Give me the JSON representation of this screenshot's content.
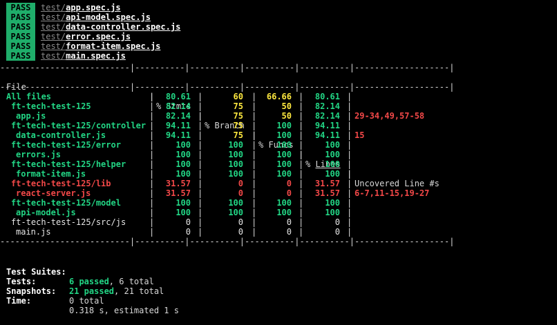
{
  "pass_label": "PASS",
  "passed_tests": [
    {
      "dir": "test/",
      "file": "app.spec.js"
    },
    {
      "dir": "test/",
      "file": "api-model.spec.js"
    },
    {
      "dir": "test/",
      "file": "data-controller.spec.js"
    },
    {
      "dir": "test/",
      "file": "error.spec.js"
    },
    {
      "dir": "test/",
      "file": "format-item.spec.js"
    },
    {
      "dir": "test/",
      "file": "main.spec.js"
    }
  ],
  "table": {
    "separator": "--------------------------|----------|----------|----------|----------|-------------------|",
    "headers": {
      "file": "File",
      "stmts": "% Stmts",
      "branch": "% Branch",
      "funcs": "% Funcs",
      "lines_prefix": "% ",
      "lines_word": "Lines",
      "uncovered": "Uncovered Line #s"
    },
    "rows": [
      {
        "name": "All files",
        "indent": 0,
        "stmts": "80.61",
        "branch": "60",
        "funcs": "66.66",
        "lines": "80.61",
        "uncovered": "",
        "c_name": "green",
        "c_stmts": "green",
        "c_branch": "yellow",
        "c_funcs": "yellow",
        "c_lines": "green"
      },
      {
        "name": "ft-tech-test-125",
        "indent": 1,
        "stmts": "82.14",
        "branch": "75",
        "funcs": "50",
        "lines": "82.14",
        "uncovered": "",
        "c_name": "green",
        "c_stmts": "green",
        "c_branch": "yellow",
        "c_funcs": "yellow",
        "c_lines": "green"
      },
      {
        "name": "app.js",
        "indent": 2,
        "stmts": "82.14",
        "branch": "75",
        "funcs": "50",
        "lines": "82.14",
        "uncovered": "29-34,49,57-58",
        "c_name": "green",
        "c_stmts": "green",
        "c_branch": "yellow",
        "c_funcs": "yellow",
        "c_lines": "green"
      },
      {
        "name": "ft-tech-test-125/controller",
        "indent": 1,
        "stmts": "94.11",
        "branch": "75",
        "funcs": "100",
        "lines": "94.11",
        "uncovered": "",
        "c_name": "green",
        "c_stmts": "green",
        "c_branch": "yellow",
        "c_funcs": "green",
        "c_lines": "green"
      },
      {
        "name": "data-controller.js",
        "indent": 2,
        "stmts": "94.11",
        "branch": "75",
        "funcs": "100",
        "lines": "94.11",
        "uncovered": "15",
        "c_name": "green",
        "c_stmts": "green",
        "c_branch": "yellow",
        "c_funcs": "green",
        "c_lines": "green"
      },
      {
        "name": "ft-tech-test-125/error",
        "indent": 1,
        "stmts": "100",
        "branch": "100",
        "funcs": "100",
        "lines": "100",
        "uncovered": "",
        "c_name": "green",
        "c_stmts": "green",
        "c_branch": "green",
        "c_funcs": "green",
        "c_lines": "green"
      },
      {
        "name": "errors.js",
        "indent": 2,
        "stmts": "100",
        "branch": "100",
        "funcs": "100",
        "lines": "100",
        "uncovered": "",
        "c_name": "green",
        "c_stmts": "green",
        "c_branch": "green",
        "c_funcs": "green",
        "c_lines": "green"
      },
      {
        "name": "ft-tech-test-125/helper",
        "indent": 1,
        "stmts": "100",
        "branch": "100",
        "funcs": "100",
        "lines": "100",
        "uncovered": "",
        "c_name": "green",
        "c_stmts": "green",
        "c_branch": "green",
        "c_funcs": "green",
        "c_lines": "green"
      },
      {
        "name": "format-item.js",
        "indent": 2,
        "stmts": "100",
        "branch": "100",
        "funcs": "100",
        "lines": "100",
        "uncovered": "",
        "c_name": "green",
        "c_stmts": "green",
        "c_branch": "green",
        "c_funcs": "green",
        "c_lines": "green"
      },
      {
        "name": "ft-tech-test-125/lib",
        "indent": 1,
        "stmts": "31.57",
        "branch": "0",
        "funcs": "0",
        "lines": "31.57",
        "uncovered": "",
        "c_name": "red",
        "c_stmts": "red",
        "c_branch": "red",
        "c_funcs": "red",
        "c_lines": "red"
      },
      {
        "name": "react-server.js",
        "indent": 2,
        "stmts": "31.57",
        "branch": "0",
        "funcs": "0",
        "lines": "31.57",
        "uncovered": "6-7,11-15,19-27",
        "c_name": "red",
        "c_stmts": "red",
        "c_branch": "red",
        "c_funcs": "red",
        "c_lines": "red"
      },
      {
        "name": "ft-tech-test-125/model",
        "indent": 1,
        "stmts": "100",
        "branch": "100",
        "funcs": "100",
        "lines": "100",
        "uncovered": "",
        "c_name": "green",
        "c_stmts": "green",
        "c_branch": "green",
        "c_funcs": "green",
        "c_lines": "green"
      },
      {
        "name": "api-model.js",
        "indent": 2,
        "stmts": "100",
        "branch": "100",
        "funcs": "100",
        "lines": "100",
        "uncovered": "",
        "c_name": "green",
        "c_stmts": "green",
        "c_branch": "green",
        "c_funcs": "green",
        "c_lines": "green"
      },
      {
        "name": "ft-tech-test-125/src/js",
        "indent": 1,
        "stmts": "0",
        "branch": "0",
        "funcs": "0",
        "lines": "0",
        "uncovered": "",
        "c_name": "white",
        "c_stmts": "white",
        "c_branch": "white",
        "c_funcs": "white",
        "c_lines": "white"
      },
      {
        "name": "main.js",
        "indent": 2,
        "stmts": "0",
        "branch": "0",
        "funcs": "0",
        "lines": "0",
        "uncovered": "",
        "c_name": "white",
        "c_stmts": "white",
        "c_branch": "white",
        "c_funcs": "white",
        "c_lines": "white"
      }
    ]
  },
  "summary": {
    "suites_label": "Test Suites:",
    "suites_passed": "6 passed",
    "suites_total": ", 6 total",
    "tests_label": "Tests:",
    "tests_passed": "21 passed",
    "tests_total": ", 21 total",
    "snapshots_label": "Snapshots:",
    "snapshots_value": "0 total",
    "time_label": "Time:",
    "time_value": "0.318 s, estimated 1 s"
  },
  "colors": {
    "background": "#000000",
    "pass_badge": "#1fad6a",
    "covered": "#22d685",
    "partial": "#ffe93f",
    "uncovered": "#f24848"
  }
}
